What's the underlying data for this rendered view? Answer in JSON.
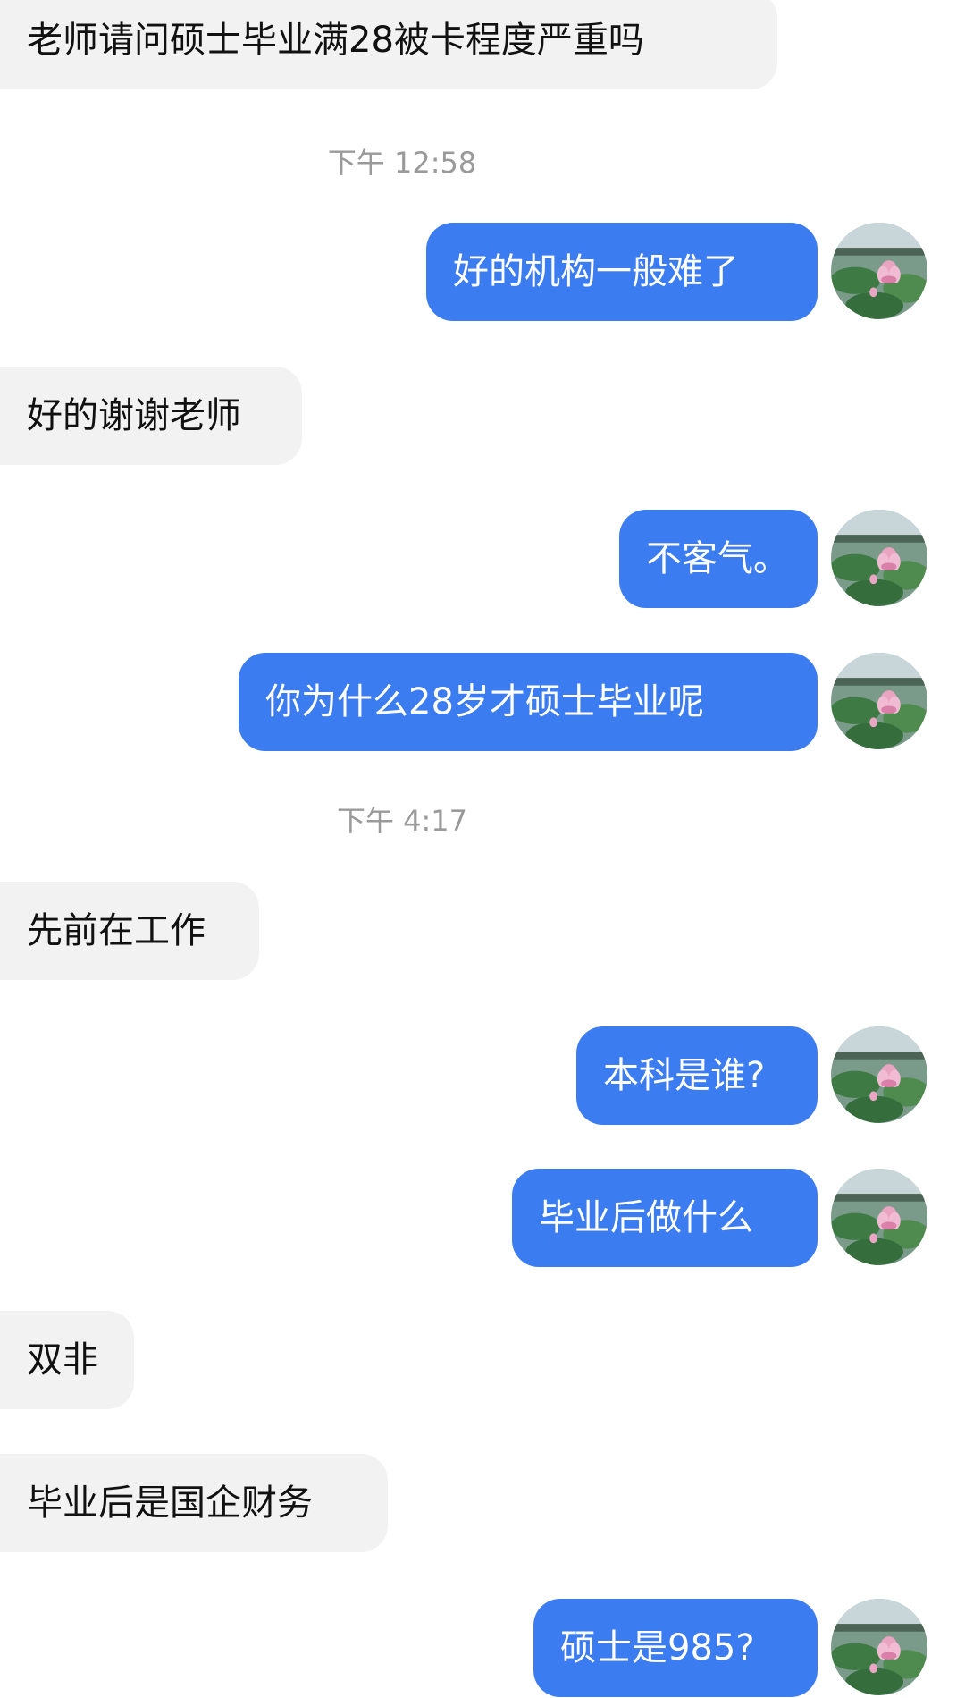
{
  "messages": [
    {
      "type": "received",
      "text": "老师请问硕士毕业满28被卡程度严重吗"
    },
    {
      "type": "timestamp",
      "text": "下午 12:58"
    },
    {
      "type": "sent",
      "text": "好的机构一般难了"
    },
    {
      "type": "received",
      "text": "好的谢谢老师"
    },
    {
      "type": "sent",
      "text": "不客气。"
    },
    {
      "type": "sent",
      "text": "你为什么28岁才硕士毕业呢"
    },
    {
      "type": "timestamp",
      "text": "下午 4:17"
    },
    {
      "type": "received",
      "text": "先前在工作"
    },
    {
      "type": "sent",
      "text": "本科是谁?"
    },
    {
      "type": "sent",
      "text": "毕业后做什么"
    },
    {
      "type": "received",
      "text": "双非"
    },
    {
      "type": "received",
      "text": "毕业后是国企财务"
    },
    {
      "type": "sent",
      "text": "硕士是985?"
    }
  ],
  "colors": {
    "sent_bubble": "#3b7cf0",
    "received_bubble": "#f2f2f2",
    "timestamp_text": "#9a9a9a"
  },
  "avatar_icon": "lotus-pond-avatar-icon"
}
